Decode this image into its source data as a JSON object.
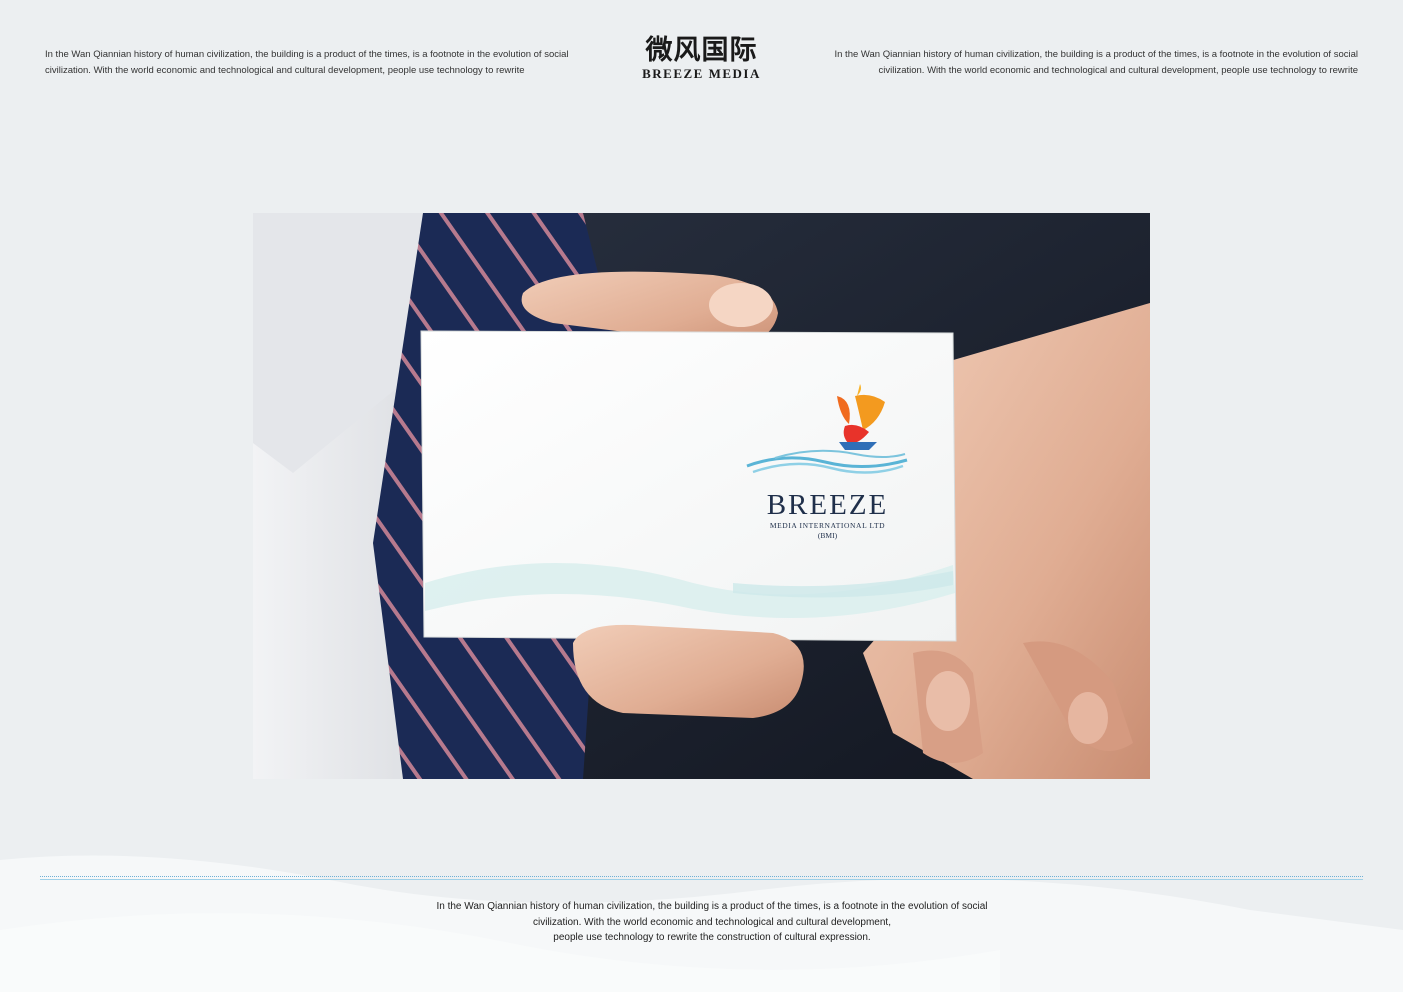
{
  "header": {
    "left_text": "In the Wan Qiannian history of human civilization, the building is a product of the times, is a footnote in the evolution of social civilization. With the world economic and technological and cultural development, people use technology to rewrite",
    "right_text": "In the Wan Qiannian history of human civilization, the building is a product of the times, is a footnote in the evolution of social civilization. With the world economic and technological and cultural development, people use technology to rewrite",
    "brand_cn": "微风国际",
    "brand_en": "BREEZE MEDIA"
  },
  "card": {
    "brand_name": "BREEZE",
    "brand_sub": "MEDIA INTERNATIONAL LTD",
    "brand_abbr": "(BMI)",
    "logo_icon": "sailboat-waves-logo"
  },
  "footer": {
    "line1": "In the Wan Qiannian history of human civilization, the building is a product of the times, is a footnote in the evolution of social",
    "line2": "civilization. With the world economic and technological and cultural development,",
    "line3": "people use technology to rewrite the construction of cultural expression."
  },
  "colors": {
    "background": "#eceff1",
    "divider": "#6fb0d6",
    "sail_red": "#e8332a",
    "sail_orange": "#f39a1f",
    "wave_blue": "#5ab4d6"
  }
}
